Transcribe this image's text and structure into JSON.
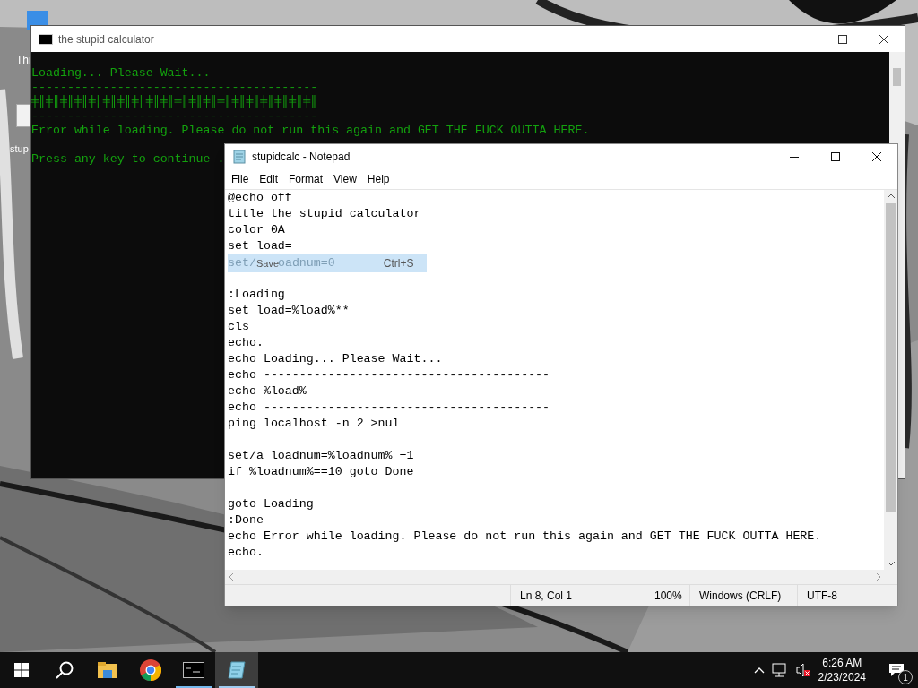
{
  "desktop": {
    "icon_labels": [
      "Thi",
      "stup"
    ]
  },
  "console_window": {
    "title": "the stupid calculator",
    "lines": [
      {
        "kind": "text",
        "text": "Loading... Please Wait..."
      },
      {
        "kind": "text",
        "text": "----------------------------------------"
      },
      {
        "kind": "text",
        "text": "╪║╪║╪║╪║╪║╪║╪║╪║╪║╪║╪║╪║╪║╪║╪║╪║╪║╪║╪║╪║"
      },
      {
        "kind": "text",
        "text": "----------------------------------------"
      },
      {
        "kind": "text",
        "text": "Error while loading. Please do not run this again and GET THE FUCK OUTTA HERE."
      },
      {
        "kind": "blank"
      },
      {
        "kind": "text",
        "text": "Press any key to continue ."
      }
    ]
  },
  "notepad": {
    "title": "stupidcalc - Notepad",
    "menu": [
      "File",
      "Edit",
      "Format",
      "View",
      "Help"
    ],
    "lines": [
      {
        "kind": "code",
        "text": "@echo off"
      },
      {
        "kind": "code",
        "text": "title the stupid calculator"
      },
      {
        "kind": "code",
        "text": "color 0A"
      },
      {
        "kind": "code",
        "text": "set load="
      },
      {
        "kind": "highlighted",
        "text_before": "set/",
        "menu_label": "Save",
        "text_after": "oadnum=0",
        "shortcut": "Ctrl+S"
      },
      {
        "kind": "blank"
      },
      {
        "kind": "code",
        "text": ":Loading"
      },
      {
        "kind": "code",
        "text": "set load=%load%**"
      },
      {
        "kind": "code",
        "text": "cls"
      },
      {
        "kind": "code",
        "text": "echo."
      },
      {
        "kind": "code",
        "text": "echo Loading... Please Wait..."
      },
      {
        "kind": "code",
        "text": "echo ----------------------------------------"
      },
      {
        "kind": "code",
        "text": "echo %load%"
      },
      {
        "kind": "code",
        "text": "echo ----------------------------------------"
      },
      {
        "kind": "code",
        "text": "ping localhost -n 2 >nul"
      },
      {
        "kind": "blank"
      },
      {
        "kind": "code",
        "text": "set/a loadnum=%loadnum% +1"
      },
      {
        "kind": "code",
        "text": "if %loadnum%==10 goto Done"
      },
      {
        "kind": "blank"
      },
      {
        "kind": "code",
        "text": "goto Loading"
      },
      {
        "kind": "code",
        "text": ":Done"
      },
      {
        "kind": "code",
        "text": "echo Error while loading. Please do not run this again and GET THE FUCK OUTTA HERE."
      },
      {
        "kind": "code",
        "text": "echo."
      }
    ],
    "status_bar": [
      "Ln 8, Col 1",
      "100%",
      "Windows (CRLF)",
      "UTF-8"
    ]
  },
  "taskbar": {
    "apps": [
      {
        "kind": "explorer",
        "selected": false
      },
      {
        "kind": "browser",
        "selected": false
      },
      {
        "kind": "terminal",
        "selected": false
      },
      {
        "kind": "notepad",
        "selected": true
      }
    ],
    "time": "6:26 AM",
    "date": "2/23/2024",
    "notifications": "1"
  }
}
